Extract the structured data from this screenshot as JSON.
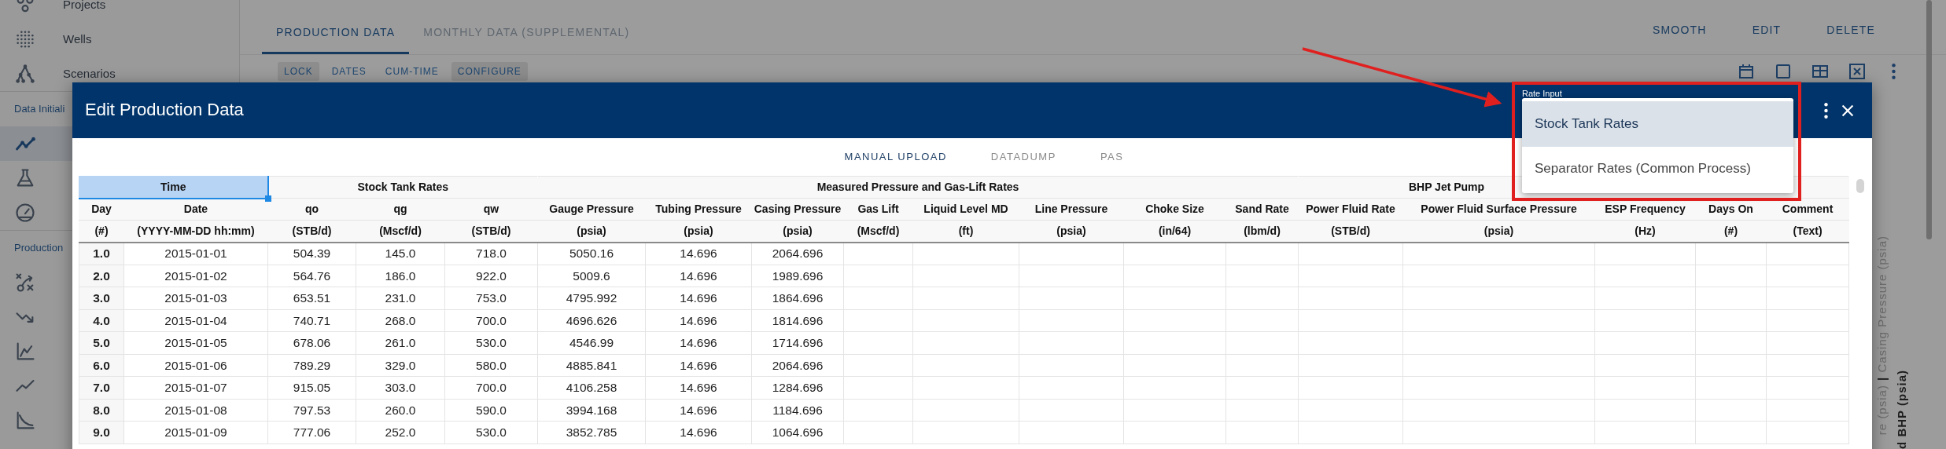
{
  "sidebar": {
    "entries": [
      {
        "kind": "item",
        "label": "Projects",
        "selected": false
      },
      {
        "kind": "item",
        "label": "Wells",
        "selected": false
      },
      {
        "kind": "item",
        "label": "Scenarios",
        "selected": false
      },
      {
        "kind": "heading",
        "label": "Data Initiali"
      },
      {
        "kind": "item",
        "selected": true
      },
      {
        "kind": "item",
        "selected": false
      },
      {
        "kind": "item",
        "selected": false
      },
      {
        "kind": "heading",
        "label": "Production"
      },
      {
        "kind": "item",
        "selected": false
      },
      {
        "kind": "item",
        "selected": false
      },
      {
        "kind": "item",
        "selected": false
      },
      {
        "kind": "item",
        "selected": false
      },
      {
        "kind": "item",
        "selected": false
      }
    ]
  },
  "page": {
    "tabs": [
      {
        "label": "PRODUCTION DATA",
        "selected": true
      },
      {
        "label": "MONTHLY DATA (SUPPLEMENTAL)",
        "selected": false
      }
    ],
    "actions": [
      "SMOOTH",
      "EDIT",
      "DELETE"
    ],
    "toolbar": [
      {
        "label": "LOCK",
        "on": true
      },
      {
        "label": "DATES",
        "on": false
      },
      {
        "label": "CUM-TIME",
        "on": false
      },
      {
        "label": "CONFIGURE",
        "on": true
      }
    ],
    "axis_titles": [
      [
        {
          "text": "re (psia)",
          "muted": true
        },
        {
          "text": "|",
          "muted": false
        },
        {
          "text": "Casing Pressure (psia)",
          "muted": true
        }
      ],
      [
        {
          "text": "d BHP (psia)",
          "muted": false
        }
      ]
    ]
  },
  "dialog": {
    "title": "Edit Production Data",
    "subtabs": [
      {
        "label": "MANUAL UPLOAD",
        "selected": true
      },
      {
        "label": "DATADUMP",
        "selected": false
      },
      {
        "label": "PAS",
        "selected": false
      }
    ],
    "rate_input": {
      "label": "Rate Input",
      "options": [
        {
          "label": "Stock Tank Rates",
          "selected": true
        },
        {
          "label": "Separator Rates (Common Process)",
          "selected": false
        }
      ]
    },
    "table": {
      "groups": [
        {
          "label": "Time",
          "selected": true,
          "columns": [
            {
              "name": "Day",
              "unit": "(#)"
            },
            {
              "name": "Date",
              "unit": "(YYYY-MM-DD hh:mm)"
            }
          ]
        },
        {
          "label": "Stock Tank Rates",
          "selected": false,
          "columns": [
            {
              "name": "qo",
              "unit": "(STB/d)"
            },
            {
              "name": "qg",
              "unit": "(Mscf/d)"
            },
            {
              "name": "qw",
              "unit": "(STB/d)"
            }
          ]
        },
        {
          "label": "Measured Pressure and Gas-Lift Rates",
          "selected": false,
          "columns": [
            {
              "name": "Gauge Pressure",
              "unit": "(psia)"
            },
            {
              "name": "Tubing Pressure",
              "unit": "(psia)"
            },
            {
              "name": "Casing Pressure",
              "unit": "(psia)"
            },
            {
              "name": "Gas Lift",
              "unit": "(Mscf/d)"
            },
            {
              "name": "Liquid Level MD",
              "unit": "(ft)"
            },
            {
              "name": "Line Pressure",
              "unit": "(psia)"
            },
            {
              "name": "Choke Size",
              "unit": "(in/64)"
            },
            {
              "name": "Sand Rate",
              "unit": "(lbm/d)"
            }
          ]
        },
        {
          "label": "BHP Jet Pump",
          "selected": false,
          "columns": [
            {
              "name": "Power Fluid Rate",
              "unit": "(STB/d)"
            },
            {
              "name": "Power Fluid Surface Pressure",
              "unit": "(psia)"
            }
          ]
        },
        {
          "selected": false,
          "columns": [
            {
              "name": "ESP Frequency",
              "unit": "(Hz)"
            },
            {
              "name": "Days On",
              "unit": "(#)"
            },
            {
              "name": "Comment",
              "unit": "(Text)"
            }
          ]
        }
      ],
      "rows": [
        [
          "1.0",
          "2015-01-01",
          "504.39",
          "145.0",
          "718.0",
          "5050.16",
          "14.696",
          "2064.696"
        ],
        [
          "2.0",
          "2015-01-02",
          "564.76",
          "186.0",
          "922.0",
          "5009.6",
          "14.696",
          "1989.696"
        ],
        [
          "3.0",
          "2015-01-03",
          "653.51",
          "231.0",
          "753.0",
          "4795.992",
          "14.696",
          "1864.696"
        ],
        [
          "4.0",
          "2015-01-04",
          "740.71",
          "268.0",
          "700.0",
          "4696.626",
          "14.696",
          "1814.696"
        ],
        [
          "5.0",
          "2015-01-05",
          "678.06",
          "261.0",
          "530.0",
          "4546.99",
          "14.696",
          "1714.696"
        ],
        [
          "6.0",
          "2015-01-06",
          "789.29",
          "329.0",
          "580.0",
          "4885.841",
          "14.696",
          "2064.696"
        ],
        [
          "7.0",
          "2015-01-07",
          "915.05",
          "303.0",
          "700.0",
          "4106.258",
          "14.696",
          "1284.696"
        ],
        [
          "8.0",
          "2015-01-08",
          "797.53",
          "260.0",
          "590.0",
          "3994.168",
          "14.696",
          "1184.696"
        ],
        [
          "9.0",
          "2015-01-09",
          "777.06",
          "252.0",
          "530.0",
          "3852.785",
          "14.696",
          "1064.696"
        ]
      ]
    }
  },
  "annotation": {
    "kind": "arrow-frame"
  }
}
